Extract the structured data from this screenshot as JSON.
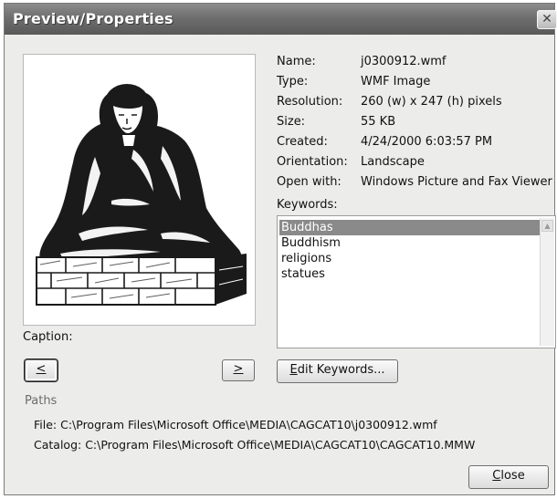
{
  "dialog": {
    "title": "Preview/Properties",
    "close_glyph": "✕"
  },
  "properties": [
    {
      "label": "Name:",
      "value": "j0300912.wmf"
    },
    {
      "label": "Type:",
      "value": "WMF Image"
    },
    {
      "label": "Resolution:",
      "value": "260 (w) x 247 (h) pixels"
    },
    {
      "label": "Size:",
      "value": "55 KB"
    },
    {
      "label": "Created:",
      "value": "4/24/2000 6:03:57 PM"
    },
    {
      "label": "Orientation:",
      "value": "Landscape"
    },
    {
      "label": "Open with:",
      "value": "Windows Picture and Fax Viewer"
    }
  ],
  "keywords": {
    "label": "Keywords:",
    "items": [
      "Buddhas",
      "Buddhism",
      "religions",
      "statues"
    ],
    "selected_index": 0
  },
  "caption": {
    "label": "Caption:"
  },
  "buttons": {
    "prev_label": "<",
    "next_label": ">",
    "edit_keywords_prefix": "E",
    "edit_keywords_rest": "dit Keywords...",
    "close_prefix": "C",
    "close_rest": "lose"
  },
  "paths": {
    "label": "Paths",
    "file": "File:  C:\\Program Files\\Microsoft Office\\MEDIA\\CAGCAT10\\j0300912.wmf",
    "catalog": "Catalog:  C:\\Program Files\\Microsoft Office\\MEDIA\\CAGCAT10\\CAGCAT10.MMW"
  },
  "preview": {
    "image_subject": "buddha-statue",
    "ink_color": "#1a1a1a",
    "light_color": "#ffffff"
  },
  "icons": {
    "close": "close-icon",
    "scroll_up": "scroll-up-icon"
  }
}
